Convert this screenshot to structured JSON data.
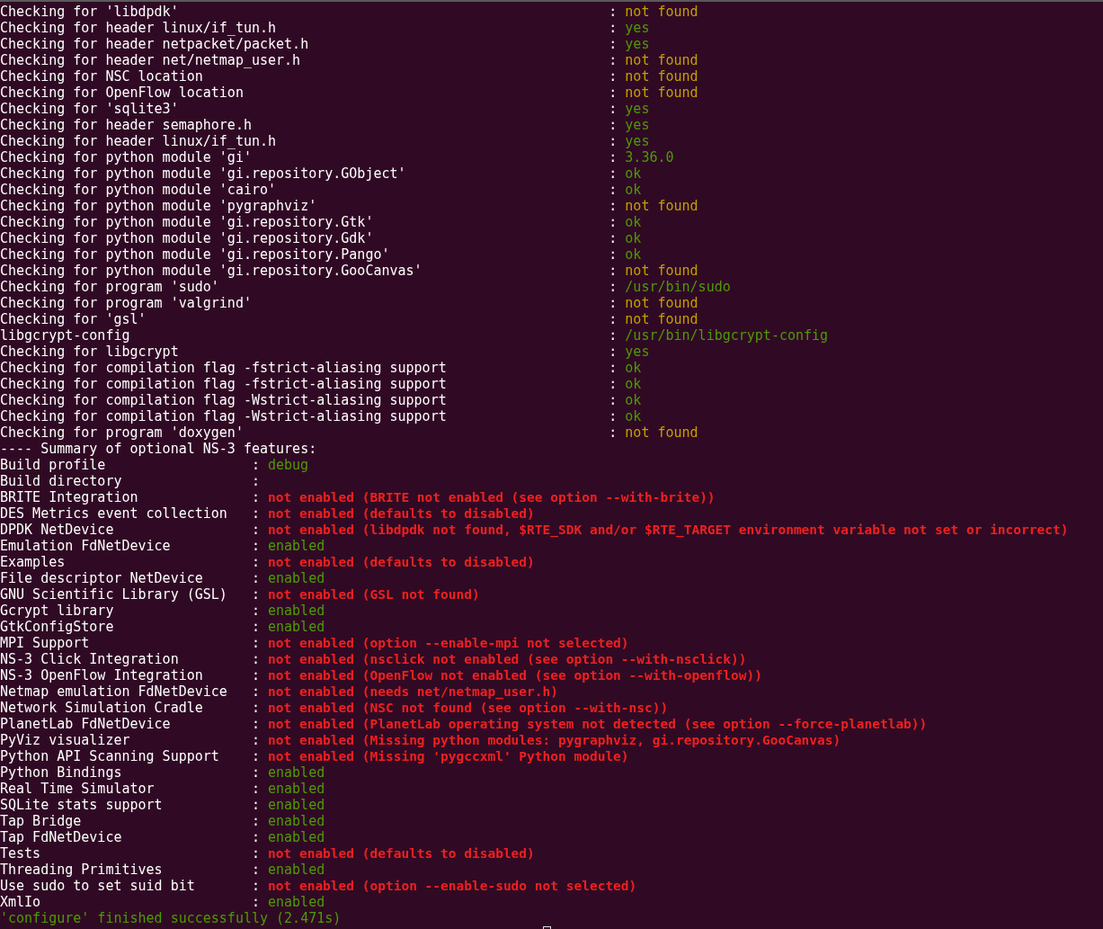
{
  "separator": ":",
  "checks": [
    {
      "label": "Checking for 'libdpdk'",
      "result": "not found",
      "kind": "missing"
    },
    {
      "label": "Checking for header linux/if_tun.h",
      "result": "yes",
      "kind": "found"
    },
    {
      "label": "Checking for header netpacket/packet.h",
      "result": "yes",
      "kind": "found"
    },
    {
      "label": "Checking for header net/netmap_user.h",
      "result": "not found",
      "kind": "missing"
    },
    {
      "label": "Checking for NSC location",
      "result": "not found",
      "kind": "missing"
    },
    {
      "label": "Checking for OpenFlow location",
      "result": "not found",
      "kind": "missing"
    },
    {
      "label": "Checking for 'sqlite3'",
      "result": "yes",
      "kind": "found"
    },
    {
      "label": "Checking for header semaphore.h",
      "result": "yes",
      "kind": "found"
    },
    {
      "label": "Checking for header linux/if_tun.h",
      "result": "yes",
      "kind": "found"
    },
    {
      "label": "Checking for python module 'gi'",
      "result": "3.36.0",
      "kind": "found"
    },
    {
      "label": "Checking for python module 'gi.repository.GObject'",
      "result": "ok",
      "kind": "found"
    },
    {
      "label": "Checking for python module 'cairo'",
      "result": "ok",
      "kind": "found"
    },
    {
      "label": "Checking for python module 'pygraphviz'",
      "result": "not found",
      "kind": "missing"
    },
    {
      "label": "Checking for python module 'gi.repository.Gtk'",
      "result": "ok",
      "kind": "found"
    },
    {
      "label": "Checking for python module 'gi.repository.Gdk'",
      "result": "ok",
      "kind": "found"
    },
    {
      "label": "Checking for python module 'gi.repository.Pango'",
      "result": "ok",
      "kind": "found"
    },
    {
      "label": "Checking for python module 'gi.repository.GooCanvas'",
      "result": "not found",
      "kind": "missing"
    },
    {
      "label": "Checking for program 'sudo'",
      "result": "/usr/bin/sudo",
      "kind": "found"
    },
    {
      "label": "Checking for program 'valgrind'",
      "result": "not found",
      "kind": "missing"
    },
    {
      "label": "Checking for 'gsl'",
      "result": "not found",
      "kind": "missing"
    },
    {
      "label": "libgcrypt-config",
      "result": "/usr/bin/libgcrypt-config",
      "kind": "found"
    },
    {
      "label": "Checking for libgcrypt",
      "result": "yes",
      "kind": "found"
    },
    {
      "label": "Checking for compilation flag -fstrict-aliasing support",
      "result": "ok",
      "kind": "found"
    },
    {
      "label": "Checking for compilation flag -fstrict-aliasing support",
      "result": "ok",
      "kind": "found"
    },
    {
      "label": "Checking for compilation flag -Wstrict-aliasing support",
      "result": "ok",
      "kind": "found"
    },
    {
      "label": "Checking for compilation flag -Wstrict-aliasing support",
      "result": "ok",
      "kind": "found"
    },
    {
      "label": "Checking for program 'doxygen'",
      "result": "not found",
      "kind": "missing"
    }
  ],
  "summary_heading": "---- Summary of optional NS-3 features:",
  "features": [
    {
      "name": "Build profile",
      "value": "debug",
      "kind": "enabled"
    },
    {
      "name": "Build directory"
    },
    {
      "name": "BRITE Integration",
      "value": "not enabled (BRITE not enabled (see option --with-brite))",
      "kind": "disabled"
    },
    {
      "name": "DES Metrics event collection",
      "value": "not enabled (defaults to disabled)",
      "kind": "disabled"
    },
    {
      "name": "DPDK NetDevice",
      "value": "not enabled (libdpdk not found, $RTE_SDK and/or $RTE_TARGET environment variable not set or incorrect)",
      "kind": "disabled"
    },
    {
      "name": "Emulation FdNetDevice",
      "value": "enabled",
      "kind": "enabled"
    },
    {
      "name": "Examples",
      "value": "not enabled (defaults to disabled)",
      "kind": "disabled"
    },
    {
      "name": "File descriptor NetDevice",
      "value": "enabled",
      "kind": "enabled"
    },
    {
      "name": "GNU Scientific Library (GSL)",
      "value": "not enabled (GSL not found)",
      "kind": "disabled"
    },
    {
      "name": "Gcrypt library",
      "value": "enabled",
      "kind": "enabled"
    },
    {
      "name": "GtkConfigStore",
      "value": "enabled",
      "kind": "enabled"
    },
    {
      "name": "MPI Support",
      "value": "not enabled (option --enable-mpi not selected)",
      "kind": "disabled"
    },
    {
      "name": "NS-3 Click Integration",
      "value": "not enabled (nsclick not enabled (see option --with-nsclick))",
      "kind": "disabled"
    },
    {
      "name": "NS-3 OpenFlow Integration",
      "value": "not enabled (OpenFlow not enabled (see option --with-openflow))",
      "kind": "disabled"
    },
    {
      "name": "Netmap emulation FdNetDevice",
      "value": "not enabled (needs net/netmap_user.h)",
      "kind": "disabled"
    },
    {
      "name": "Network Simulation Cradle",
      "value": "not enabled (NSC not found (see option --with-nsc))",
      "kind": "disabled"
    },
    {
      "name": "PlanetLab FdNetDevice",
      "value": "not enabled (PlanetLab operating system not detected (see option --force-planetlab))",
      "kind": "disabled"
    },
    {
      "name": "PyViz visualizer",
      "value": "not enabled (Missing python modules: pygraphviz, gi.repository.GooCanvas)",
      "kind": "disabled"
    },
    {
      "name": "Python API Scanning Support",
      "value": "not enabled (Missing 'pygccxml' Python module)",
      "kind": "disabled"
    },
    {
      "name": "Python Bindings",
      "value": "enabled",
      "kind": "enabled"
    },
    {
      "name": "Real Time Simulator",
      "value": "enabled",
      "kind": "enabled"
    },
    {
      "name": "SQLite stats support",
      "value": "enabled",
      "kind": "enabled"
    },
    {
      "name": "Tap Bridge",
      "value": "enabled",
      "kind": "enabled"
    },
    {
      "name": "Tap FdNetDevice",
      "value": "enabled",
      "kind": "enabled"
    },
    {
      "name": "Tests",
      "value": "not enabled (defaults to disabled)",
      "kind": "disabled"
    },
    {
      "name": "Threading Primitives",
      "value": "enabled",
      "kind": "enabled"
    },
    {
      "name": "Use sudo to set suid bit",
      "value": "not enabled (option --enable-sudo not selected)",
      "kind": "disabled"
    },
    {
      "name": "XmlIo",
      "value": "enabled",
      "kind": "enabled"
    }
  ],
  "final_message": "'configure' finished successfully (2.471s)"
}
